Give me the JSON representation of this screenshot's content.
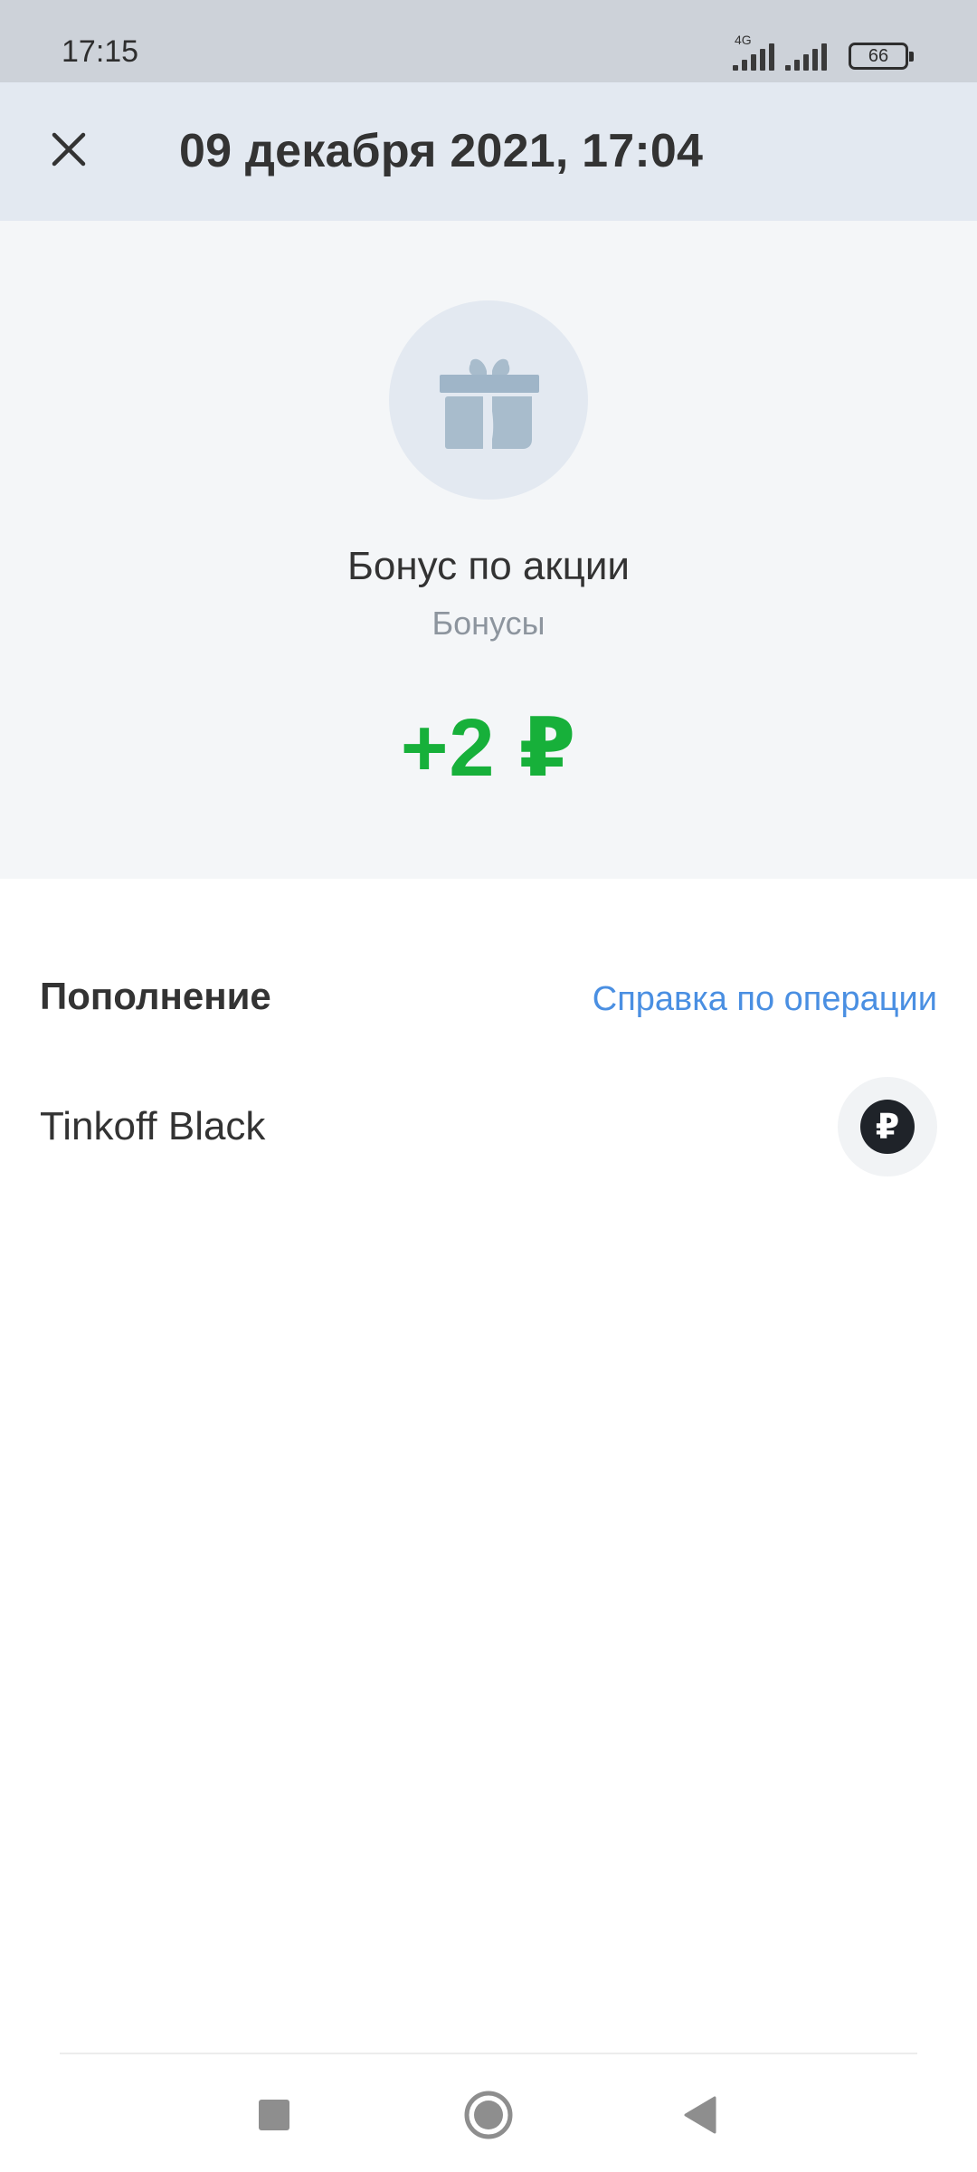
{
  "status_bar": {
    "time": "17:15",
    "network_type": "4G",
    "battery": "66",
    "icons": [
      "signal-4g-icon",
      "signal-icon",
      "battery-icon"
    ]
  },
  "header": {
    "title": "09 декабря 2021, 17:04",
    "close_icon": "close-icon"
  },
  "operation": {
    "icon": "gift-icon",
    "title": "Бонус по акции",
    "category": "Бонусы",
    "amount": "+2 ₽",
    "amount_color": "#17b03a"
  },
  "details": {
    "section_title": "Пополнение",
    "help_link": "Справка по операции",
    "account_name": "Tinkoff Black",
    "account_icon_symbol": "₽"
  },
  "nav": {
    "icons": [
      "recents-square-icon",
      "home-circle-icon",
      "back-triangle-icon"
    ]
  },
  "colors": {
    "accent_link": "#4a8fe2",
    "header_bg": "#e3e9f1",
    "hero_bg": "#f4f6f8"
  }
}
